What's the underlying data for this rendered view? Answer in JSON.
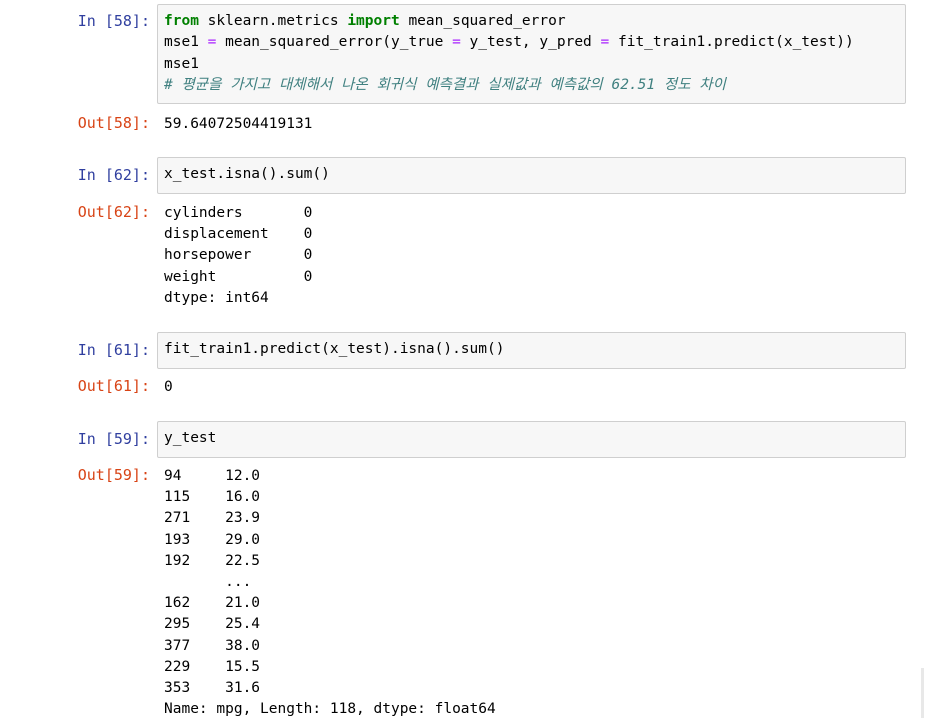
{
  "cells": [
    {
      "in_prompt": "In [58]:",
      "code": [
        {
          "parts": [
            {
              "t": "kw",
              "v": "from"
            },
            {
              "t": "tx",
              "v": " sklearn.metrics "
            },
            {
              "t": "kw",
              "v": "import"
            },
            {
              "t": "tx",
              "v": " mean_squared_error"
            }
          ]
        },
        {
          "parts": [
            {
              "t": "tx",
              "v": "mse1 "
            },
            {
              "t": "op",
              "v": "="
            },
            {
              "t": "tx",
              "v": " mean_squared_error(y_true "
            },
            {
              "t": "op",
              "v": "="
            },
            {
              "t": "tx",
              "v": " y_test, y_pred "
            },
            {
              "t": "op",
              "v": "="
            },
            {
              "t": "tx",
              "v": " fit_train1.predict(x_test))"
            }
          ]
        },
        {
          "parts": [
            {
              "t": "tx",
              "v": "mse1"
            }
          ]
        },
        {
          "parts": [
            {
              "t": "cm",
              "v": "# 평균을 가지고 대체해서 나온 회귀식 예측결과 실제값과 예측값의 62.51 정도 차이"
            }
          ]
        }
      ],
      "out_prompt": "Out[58]:",
      "output": [
        "59.64072504419131"
      ]
    },
    {
      "in_prompt": "In [62]:",
      "code": [
        {
          "parts": [
            {
              "t": "tx",
              "v": "x_test.isna().sum()"
            }
          ]
        }
      ],
      "out_prompt": "Out[62]:",
      "output": [
        "cylinders       0",
        "displacement    0",
        "horsepower      0",
        "weight          0",
        "dtype: int64"
      ]
    },
    {
      "in_prompt": "In [61]:",
      "code": [
        {
          "parts": [
            {
              "t": "tx",
              "v": "fit_train1.predict(x_test).isna().sum()"
            }
          ]
        }
      ],
      "out_prompt": "Out[61]:",
      "output": [
        "0"
      ]
    },
    {
      "in_prompt": "In [59]:",
      "code": [
        {
          "parts": [
            {
              "t": "tx",
              "v": "y_test"
            }
          ]
        }
      ],
      "out_prompt": "Out[59]:",
      "output": [
        "94     12.0",
        "115    16.0",
        "271    23.9",
        "193    29.0",
        "192    22.5",
        "       ...",
        "162    21.0",
        "295    25.4",
        "377    38.0",
        "229    15.5",
        "353    31.6",
        "Name: mpg, Length: 118, dtype: float64"
      ]
    }
  ]
}
